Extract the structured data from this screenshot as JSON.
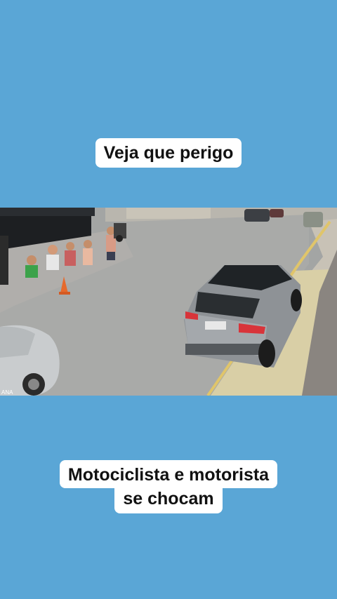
{
  "captions": {
    "top": "Veja que perigo",
    "bottom_line1": "Motociclista e motorista",
    "bottom_line2": "se chocam"
  },
  "colors": {
    "background": "#5aa6d6",
    "caption_bg": "#ffffff",
    "caption_text": "#111111"
  },
  "video": {
    "description_icon": "video-frame"
  }
}
